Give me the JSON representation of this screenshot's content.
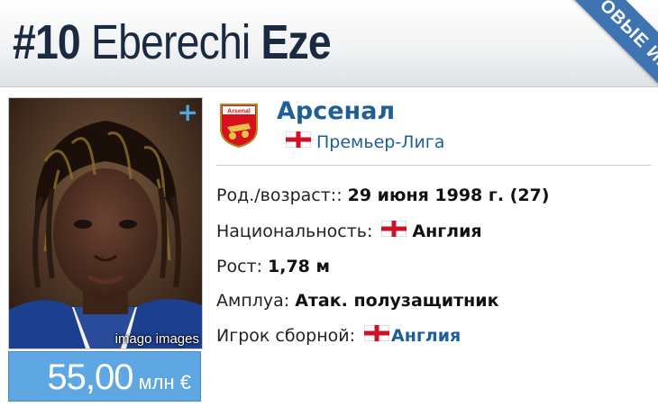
{
  "header": {
    "number": "#10",
    "first_name": "Eberechi",
    "last_name": "Eze",
    "ribbon": "ОВЫЕ ИГРОК"
  },
  "photo": {
    "credit": "imago images",
    "plus": "+"
  },
  "market_value": {
    "amount": "55,00",
    "unit": "млн €"
  },
  "club": {
    "name": "Арсенал",
    "league": "Премьер-Лига",
    "logo_text": "Arsenal"
  },
  "details": {
    "birth_label": "Род./возраст::",
    "birth_value": "29 июня 1998 г. (27)",
    "nationality_label": "Национальность:",
    "nationality_value": "Англия",
    "height_label": "Рост:",
    "height_value": "1,78 м",
    "position_label": "Амплуа:",
    "position_value": "Атак. полузащитник",
    "national_team_label": "Игрок сборной:",
    "national_team_value": "Англия"
  },
  "colors": {
    "link": "#1e5f9a",
    "value_box": "#5fa7e3",
    "ribbon": "#3f74b3",
    "title": "#1a2a40",
    "arsenal_red": "#d6131b"
  },
  "icons": {
    "plus": "plus-icon",
    "england_flag": "england-flag-icon",
    "club_crest": "arsenal-crest-icon"
  }
}
